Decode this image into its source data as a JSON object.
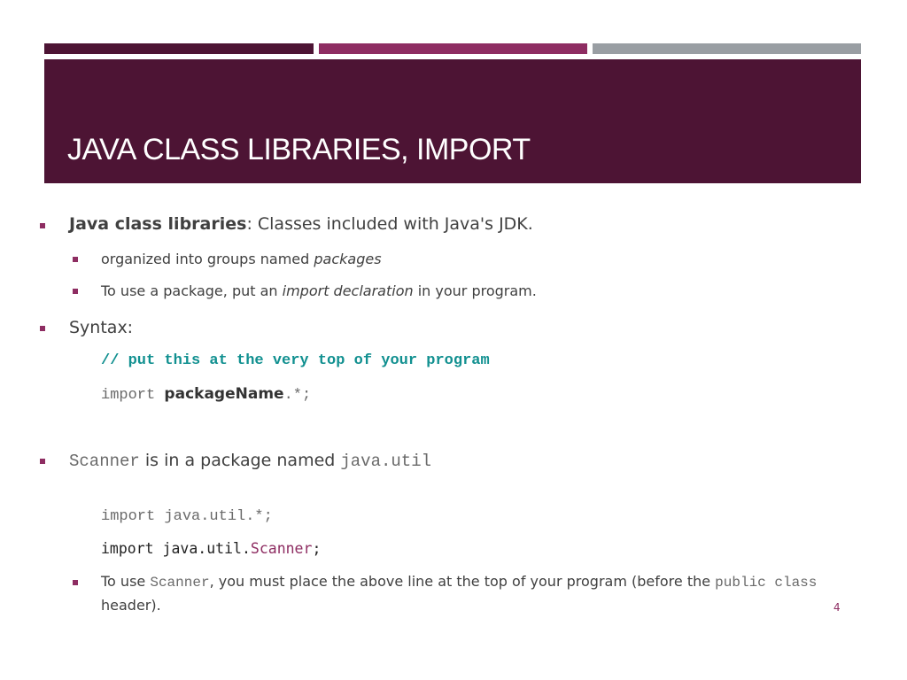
{
  "slide": {
    "title": "JAVA CLASS LIBRARIES, IMPORT",
    "page_number": "4",
    "colors": {
      "dark": "#4d1434",
      "accent": "#8e2d62",
      "grey": "#999ea3",
      "comment": "#119090"
    },
    "bullets": {
      "b1": {
        "bold": "Java class libraries",
        "rest": ": Classes included with Java's JDK."
      },
      "b1_1": {
        "text": "organized into groups named ",
        "italic": "packages"
      },
      "b1_2": {
        "pre": "To use a package, put an ",
        "italic": "import declaration",
        "post": " in your program."
      },
      "b2": {
        "text": "Syntax:"
      },
      "code_comment": "// put this at the very top of your program",
      "code_import": {
        "keyword": "import ",
        "bold": "packageName",
        "suffix": ".*;"
      },
      "b3": {
        "code1": "Scanner",
        "mid": " is in a package named ",
        "code2": "java.util"
      },
      "code_import_all": "import java.util.*;",
      "code_import_scanner": {
        "pre": "import java.util.",
        "class": "Scanner",
        "post": ";"
      },
      "b3_1": {
        "pre": "To use ",
        "code": "Scanner",
        "mid": ", you must place the above line at the top of your program (before the ",
        "code2": "public class",
        "line2": "header)."
      }
    }
  }
}
